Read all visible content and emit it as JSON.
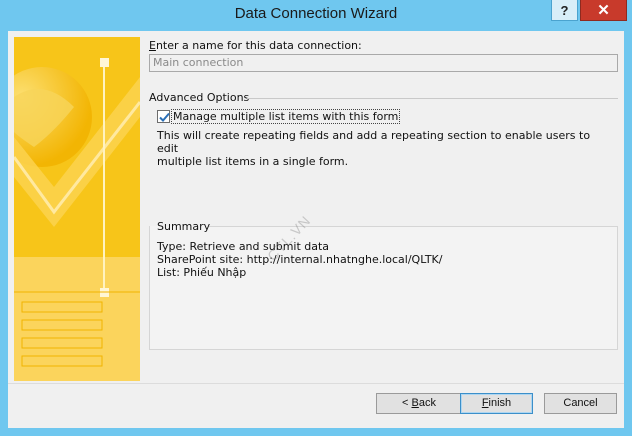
{
  "window": {
    "title": "Data Connection Wizard",
    "help_label": "?",
    "close_label": "✕"
  },
  "name_section": {
    "label_prefix": "",
    "label_accel": "E",
    "label_rest": "nter a name for this data connection:",
    "value": "Main connection"
  },
  "advanced": {
    "legend": "Advanced Options",
    "checkbox_label": "Manage multiple list items with this form",
    "checked": true,
    "description_line1": "This will create repeating fields and add a repeating section to enable users to edit",
    "description_line2": "multiple list items in a single form."
  },
  "summary": {
    "legend": "Summary",
    "type_line": "Type: Retrieve and submit data",
    "site_line": "SharePoint site: http://internal.nhatnghe.local/QLTK/",
    "list_line": "List: Phiếu Nhập"
  },
  "buttons": {
    "back_prefix": "< ",
    "back_accel": "B",
    "back_rest": "ack",
    "finish_accel": "F",
    "finish_rest": "inish",
    "cancel": "Cancel"
  },
  "watermark": "CTL.VN",
  "colors": {
    "frame": "#6fc7ef",
    "banner": "#f6c20f",
    "close_button": "#c83a2b",
    "check_accent": "#2a6fb7"
  },
  "icons": {
    "banner": "globe-and-checkmark-illustration",
    "checkbox": "checkmark-icon"
  }
}
